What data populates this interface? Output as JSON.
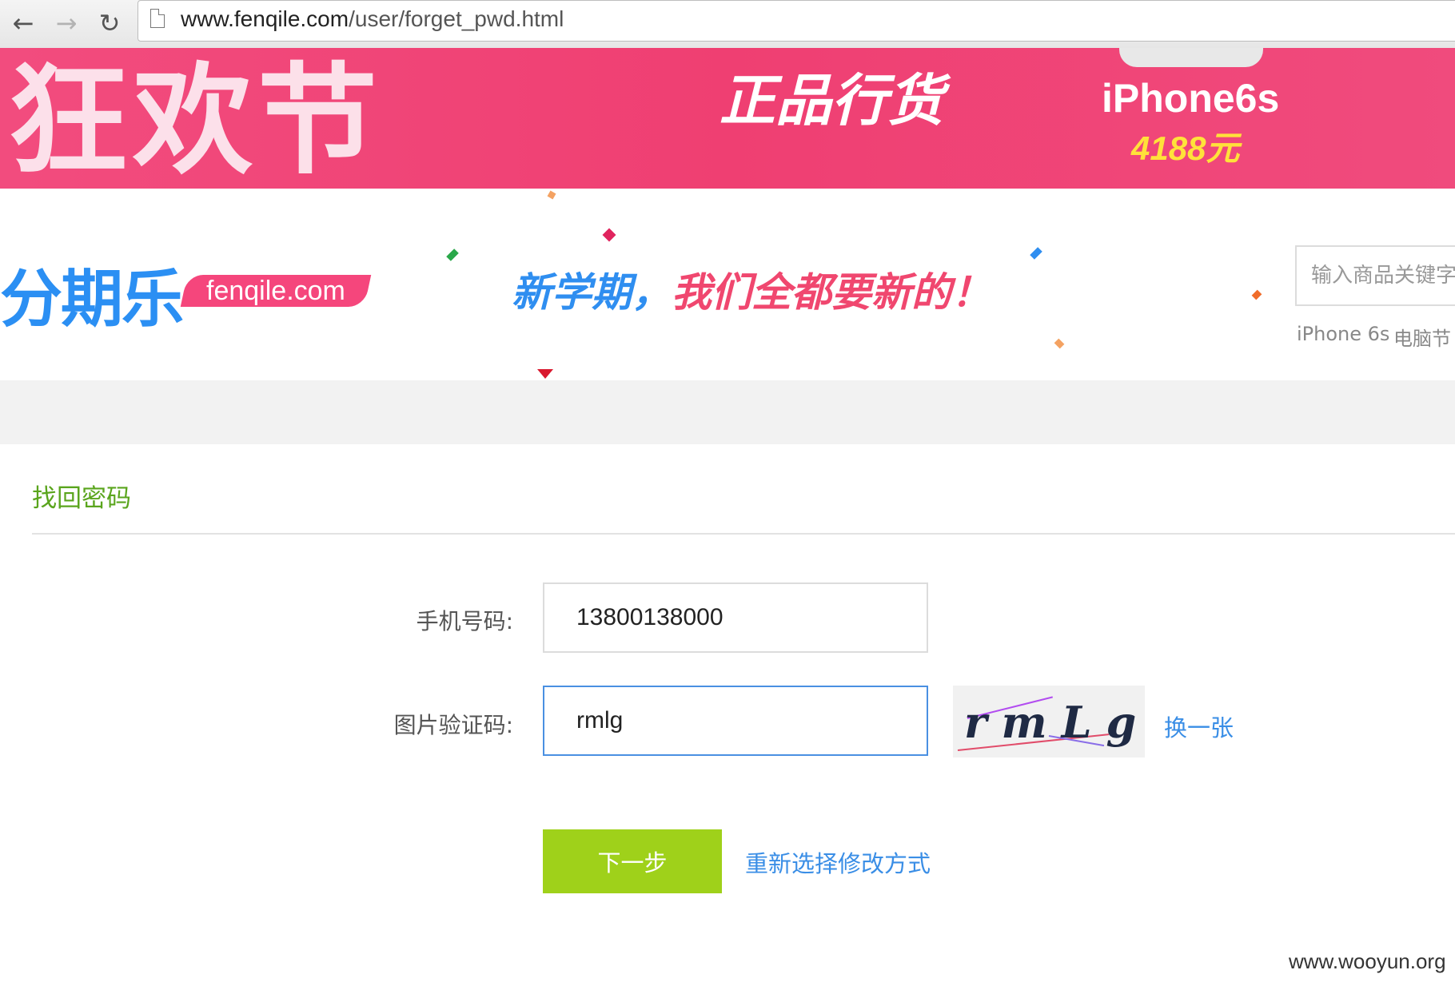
{
  "browser": {
    "url_host": "www.fenqile.com",
    "url_path": "/user/forget_pwd.html",
    "back_glyph": "←",
    "forward_glyph": "→",
    "reload_glyph": "↻"
  },
  "banner": {
    "decorative_text": "狂欢节",
    "slogan": "正品行货",
    "product": "iPhone6s",
    "price": "4188元"
  },
  "header": {
    "logo": "分期乐",
    "logo_domain": "fenqile.com",
    "campaign_part1": "新学期，",
    "campaign_part2": "我们全都要新的！",
    "search_placeholder": "输入商品关键字",
    "hot_searches": [
      "iPhone 6s",
      "电脑节"
    ]
  },
  "form": {
    "title": "找回密码",
    "phone_label": "手机号码:",
    "phone_value": "13800138000",
    "captcha_label": "图片验证码:",
    "captcha_value": "rmlg",
    "captcha_image_text": "rmLg",
    "refresh_captcha": "换一张",
    "next_button": "下一步",
    "reselect_method": "重新选择修改方式"
  },
  "watermark": "www.wooyun.org",
  "colors": {
    "banner_pink": "#ef3f72",
    "brand_blue": "#2b8ff3",
    "title_green": "#5aa51d",
    "button_green": "#9fd11a",
    "link_blue": "#3a8ee6"
  }
}
